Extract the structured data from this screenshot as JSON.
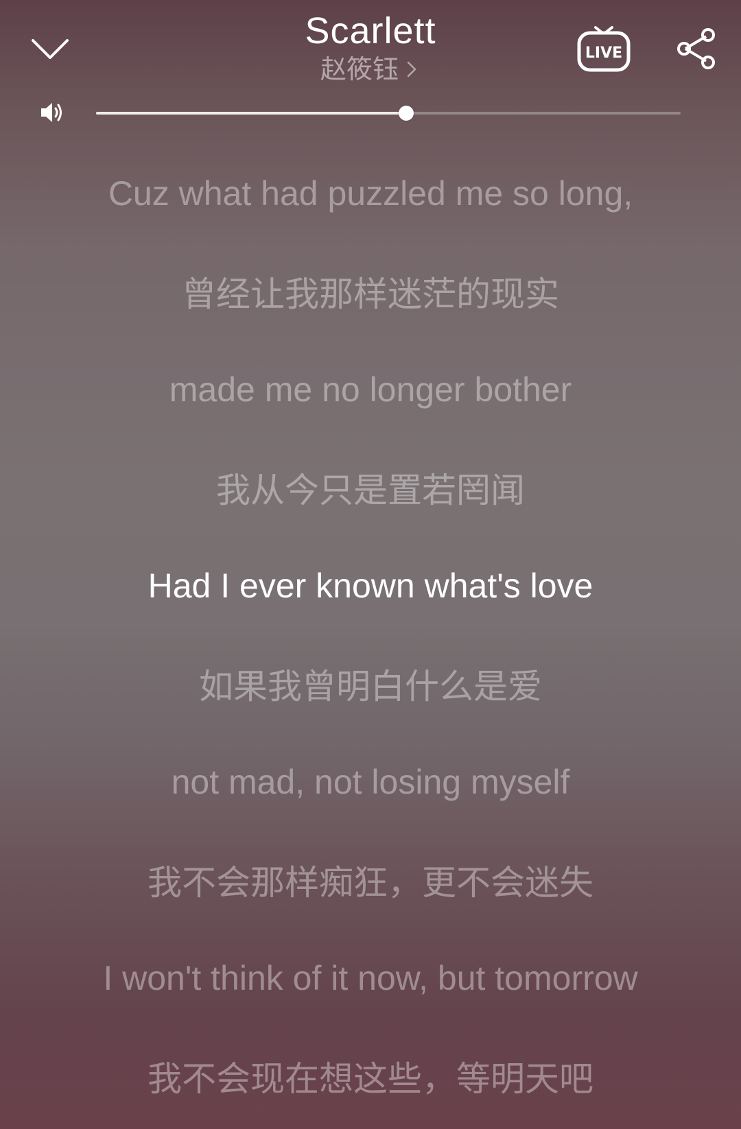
{
  "header": {
    "title": "Scarlett",
    "artist": "赵筱钰",
    "down_icon": "chevron-down-icon",
    "live_icon": "live-tv-icon",
    "live_label": "LIVE",
    "share_icon": "share-icon"
  },
  "volume": {
    "icon": "speaker-icon",
    "level": 0.53
  },
  "lyrics": [
    {
      "text": "Cuz what had puzzled me so long,",
      "active": false
    },
    {
      "text": "曾经让我那样迷茫的现实",
      "active": false
    },
    {
      "text": "made me no longer bother",
      "active": false
    },
    {
      "text": "我从今只是置若罔闻",
      "active": false
    },
    {
      "text": "Had I ever known what's love",
      "active": true
    },
    {
      "text": "如果我曾明白什么是爱",
      "active": false
    },
    {
      "text": "not mad, not losing myself",
      "active": false
    },
    {
      "text": "我不会那样痴狂，更不会迷失",
      "active": false
    },
    {
      "text": "I won't think of it now, but tomorrow",
      "active": false
    },
    {
      "text": "我不会现在想这些，等明天吧",
      "active": false
    }
  ]
}
